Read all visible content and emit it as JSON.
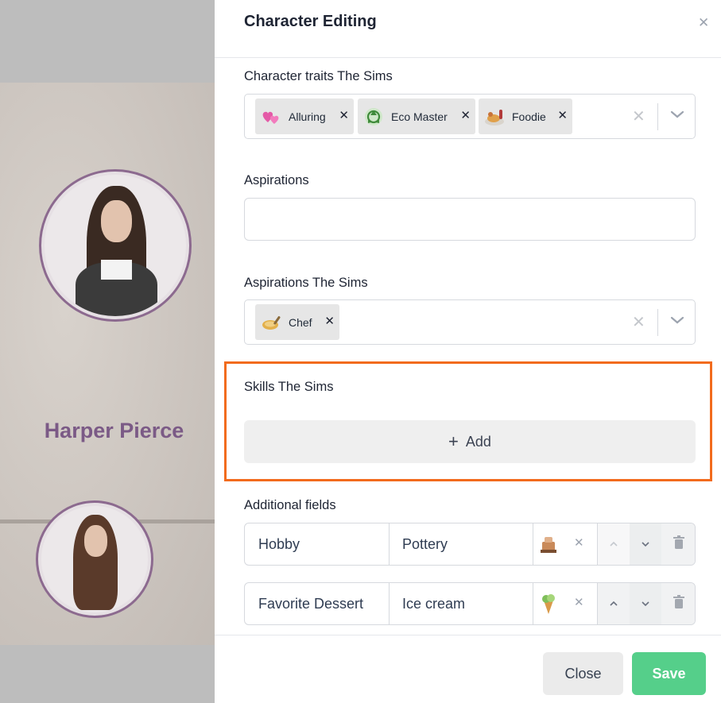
{
  "background": {
    "character_name": "Harper Pierce"
  },
  "modal": {
    "title": "Character Editing",
    "traits": {
      "label": "Character traits The Sims",
      "chips": [
        {
          "label": "Alluring",
          "icon": "hearts-icon"
        },
        {
          "label": "Eco Master",
          "icon": "recycle-icon"
        },
        {
          "label": "Foodie",
          "icon": "food-plate-icon"
        }
      ]
    },
    "aspirations": {
      "label": "Aspirations",
      "value": ""
    },
    "aspirations_sims": {
      "label": "Aspirations The Sims",
      "chips": [
        {
          "label": "Chef",
          "icon": "chef-pan-icon"
        }
      ]
    },
    "skills": {
      "label": "Skills The Sims",
      "add_label": "Add"
    },
    "additional_fields": {
      "label": "Additional fields",
      "rows": [
        {
          "key": "Hobby",
          "value": "Pottery",
          "icon": "pottery-wheel-icon"
        },
        {
          "key": "Favorite Dessert",
          "value": "Ice cream",
          "icon": "ice-cream-icon"
        }
      ]
    },
    "footer": {
      "close_label": "Close",
      "save_label": "Save"
    }
  },
  "colors": {
    "accent_green": "#55cf8a",
    "highlight_orange": "#f26b1d",
    "name_purple": "#7b5a86"
  }
}
